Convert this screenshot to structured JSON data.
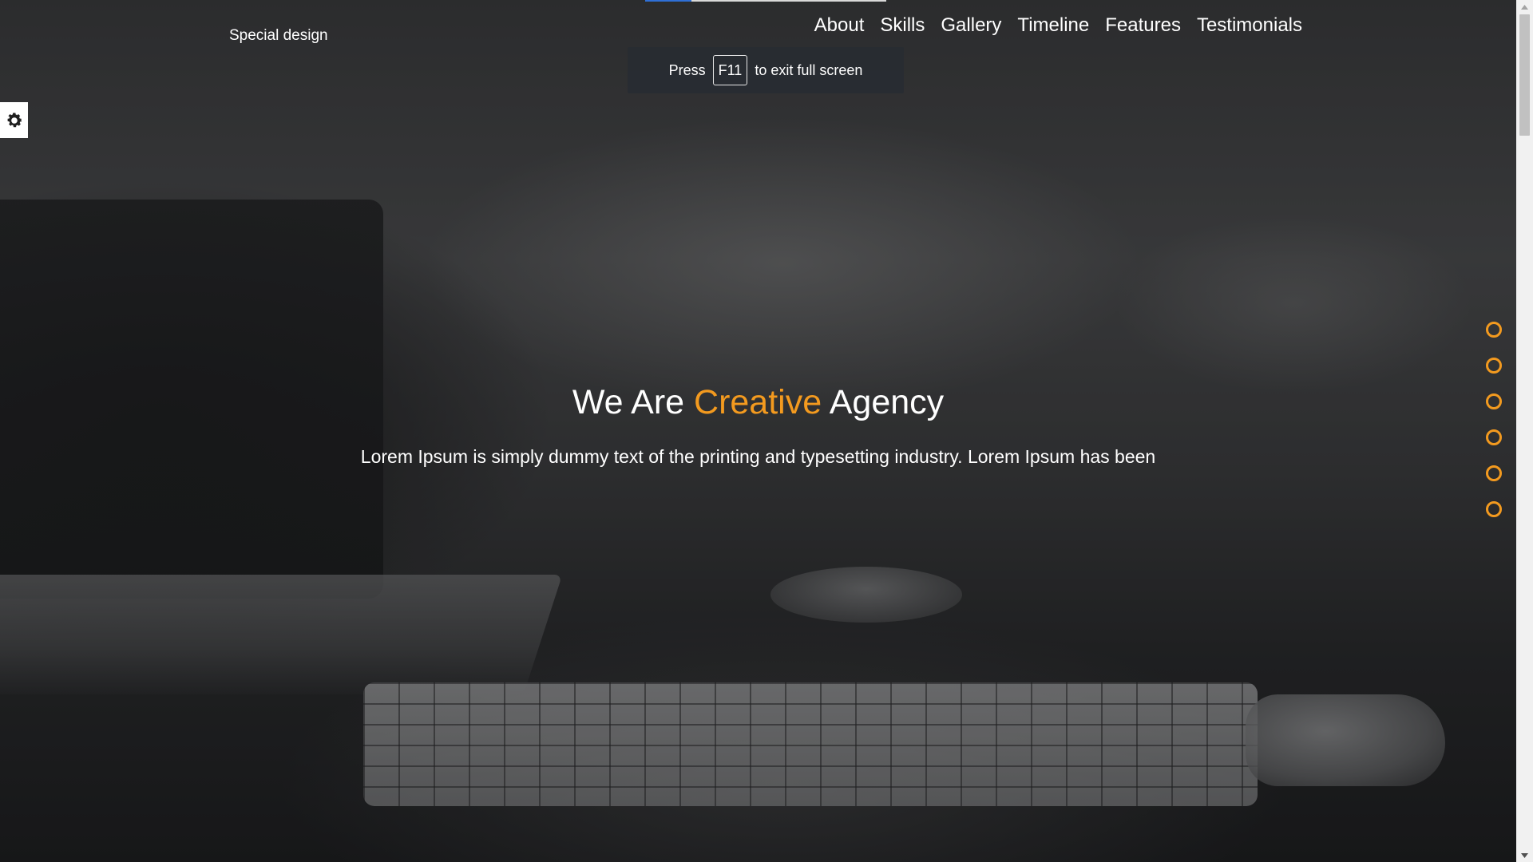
{
  "header": {
    "logo_text": "Special design",
    "nav": [
      "About",
      "Skills",
      "Gallery",
      "Timeline",
      "Features",
      "Testimonials"
    ]
  },
  "fullscreen_notice": {
    "before": "Press",
    "key": "F11",
    "after": "to exit full screen"
  },
  "hero": {
    "title_start": "We Are",
    "title_accent": "Creative",
    "title_end": "Agency",
    "text": "Lorem Ipsum is simply dummy text of the printing and typesetting industry. Lorem Ipsum has been"
  },
  "side_bullets_count": 6,
  "colors": {
    "accent": "#f39a1f",
    "text": "#ffffff"
  },
  "icons": {
    "settings": "gear-icon"
  }
}
